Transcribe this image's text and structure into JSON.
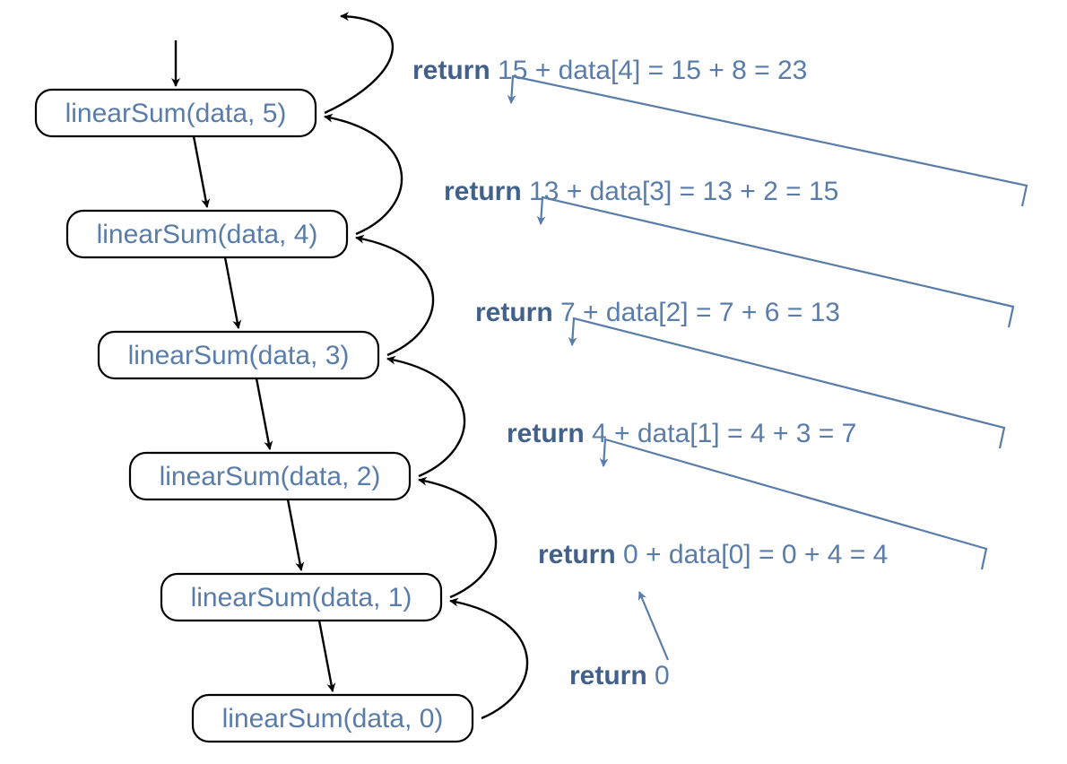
{
  "function_name": "linearSum",
  "array_name": "data",
  "data_values": [
    4,
    3,
    6,
    2,
    8
  ],
  "nodes": [
    {
      "label": "linearSum(data, 5)"
    },
    {
      "label": "linearSum(data, 4)"
    },
    {
      "label": "linearSum(data, 3)"
    },
    {
      "label": "linearSum(data, 2)"
    },
    {
      "label": "linearSum(data, 1)"
    },
    {
      "label": "linearSum(data, 0)"
    }
  ],
  "returns": [
    {
      "keyword": "return",
      "expr": " 15 + data[4] = 15 + 8 = 23"
    },
    {
      "keyword": "return",
      "expr": " 13 + data[3] = 13 + 2 = 15"
    },
    {
      "keyword": "return",
      "expr": " 7 + data[2] = 7 + 6 = 13"
    },
    {
      "keyword": "return",
      "expr": " 4 + data[1] = 4 + 3 = 7"
    },
    {
      "keyword": "return",
      "expr": " 0 + data[0] = 0 + 4 = 4"
    },
    {
      "keyword": "return",
      "expr": " 0"
    }
  ],
  "colors": {
    "text_blue": "#5a7ca8",
    "bold_blue": "#41618b",
    "arrow_blue": "#5a7ca8",
    "black": "#000"
  }
}
